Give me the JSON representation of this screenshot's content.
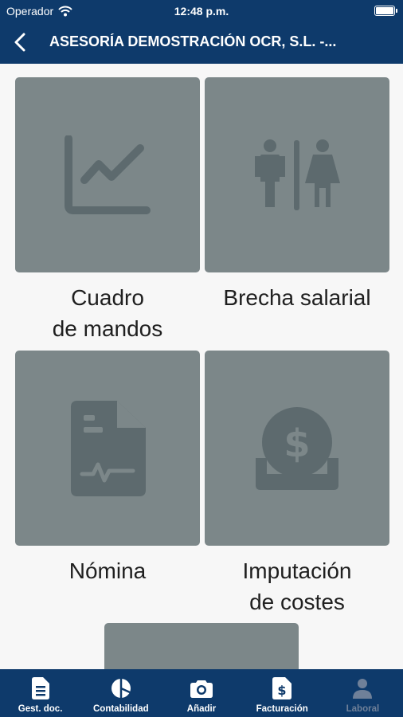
{
  "status_bar": {
    "carrier": "Operador",
    "time": "12:48 p.m."
  },
  "header": {
    "title": "ASESORÍA DEMOSTRACIÓN OCR, S.L. -..."
  },
  "cards": [
    {
      "label": "Cuadro\nde mandos",
      "icon": "chart-line-icon"
    },
    {
      "label": "Brecha salarial",
      "icon": "gender-gap-icon"
    },
    {
      "label": "Nómina",
      "icon": "payslip-document-icon"
    },
    {
      "label": "Imputación\nde costes",
      "icon": "dollar-coin-icon"
    }
  ],
  "tabs": [
    {
      "label": "Gest. doc.",
      "icon": "document-icon",
      "active": true
    },
    {
      "label": "Contabilidad",
      "icon": "pie-chart-icon",
      "active": true
    },
    {
      "label": "Añadir",
      "icon": "camera-icon",
      "active": true
    },
    {
      "label": "Facturación",
      "icon": "invoice-icon",
      "active": true
    },
    {
      "label": "Laboral",
      "icon": "person-icon",
      "active": false
    }
  ],
  "colors": {
    "header": "#0e3a6b",
    "tile": "#7c8789",
    "icon": "#5d6a6e",
    "tab_inactive": "#6f8099"
  }
}
